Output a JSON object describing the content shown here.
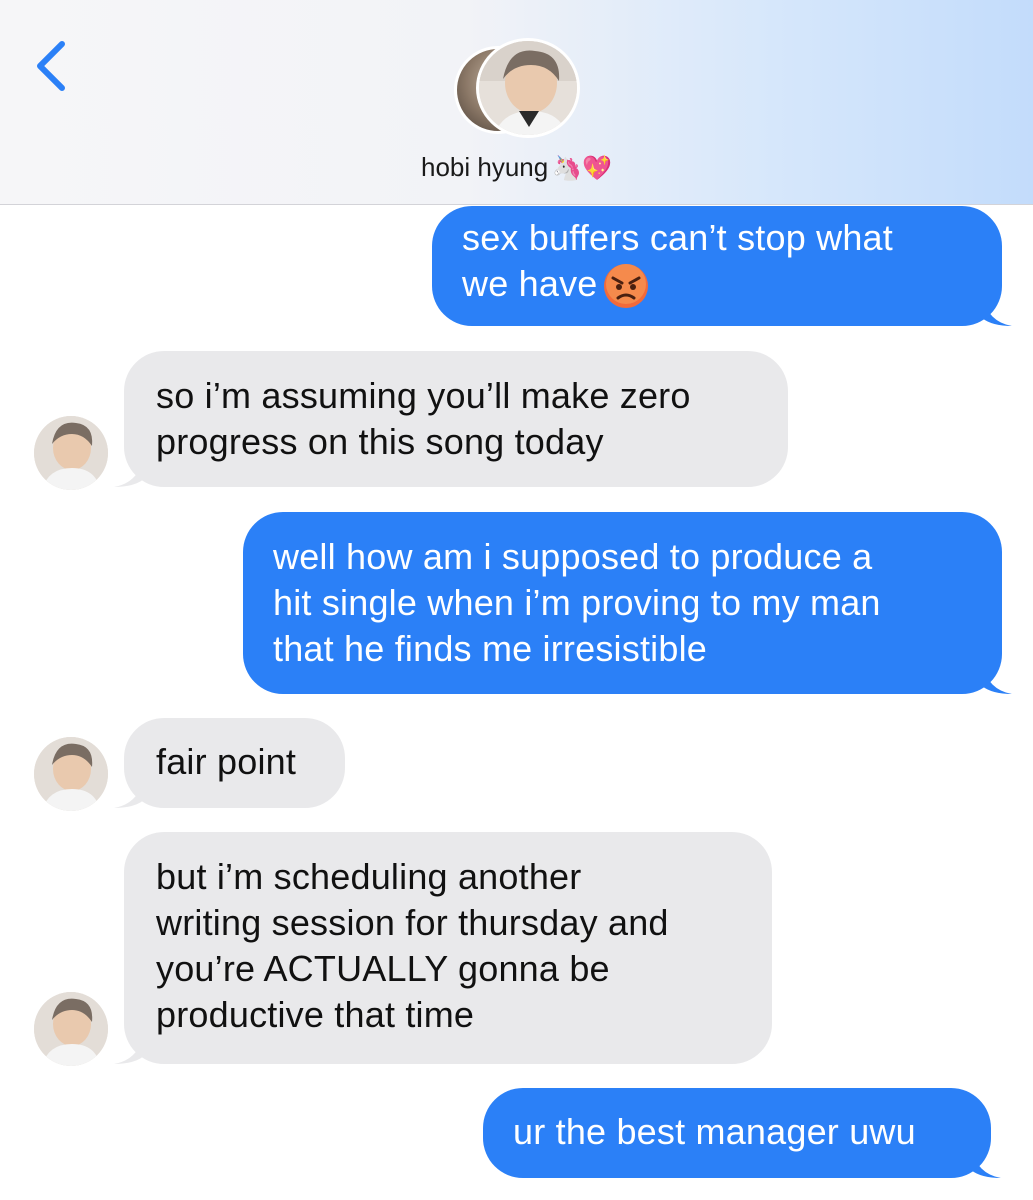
{
  "header": {
    "back_icon": "chevron-left-icon",
    "contact_name": "hobi hyung",
    "contact_emoji": "🦄💖",
    "accent": "#2b80f7"
  },
  "messages": [
    {
      "direction": "outgoing",
      "text": "sex buffers can’t stop what\nwe have",
      "emoji": "😡"
    },
    {
      "direction": "incoming",
      "text": "so i’m assuming you’ll make zero\nprogress on this song today"
    },
    {
      "direction": "outgoing",
      "text": "well how am i supposed to produce a\nhit single when i’m proving to my man\nthat he finds me irresistible"
    },
    {
      "direction": "incoming",
      "text": "fair point"
    },
    {
      "direction": "incoming",
      "text": "but i’m scheduling another\nwriting session for thursday and\nyou’re ACTUALLY gonna be\nproductive that time"
    },
    {
      "direction": "outgoing",
      "text": "ur the best manager uwu"
    }
  ],
  "colors": {
    "outgoing_bubble": "#2b80f7",
    "incoming_bubble": "#e9e9eb"
  }
}
